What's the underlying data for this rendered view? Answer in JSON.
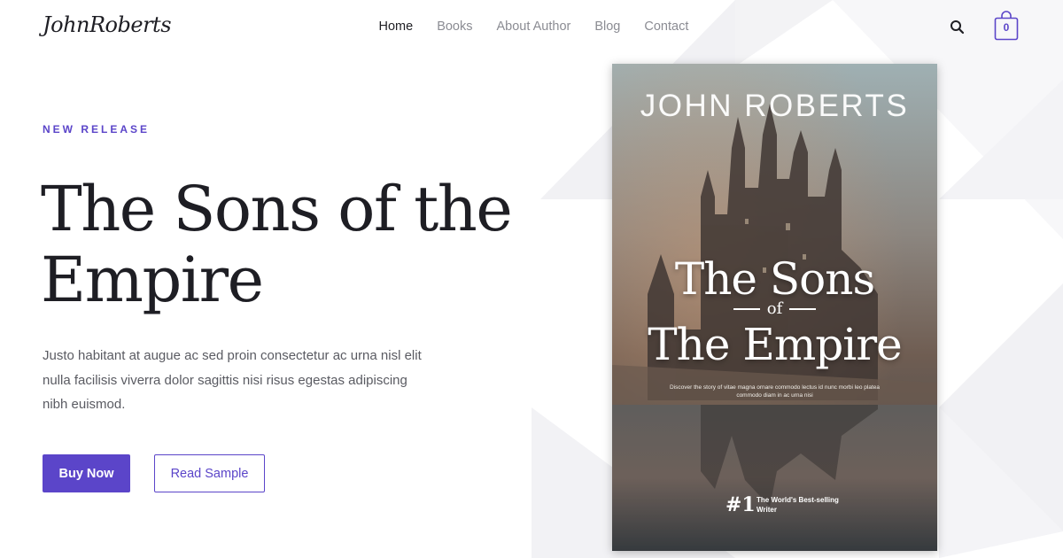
{
  "header": {
    "logo": "JohnRoberts",
    "nav": [
      {
        "label": "Home",
        "active": true
      },
      {
        "label": "Books",
        "active": false
      },
      {
        "label": "About Author",
        "active": false
      },
      {
        "label": "Blog",
        "active": false
      },
      {
        "label": "Contact",
        "active": false
      }
    ],
    "search_icon": "search-icon",
    "cart_icon": "shopping-bag-icon",
    "cart_count": "0"
  },
  "hero": {
    "eyebrow": "NEW RELEASE",
    "title": "The Sons of the Empire",
    "description": "Justo habitant at augue ac sed proin consectetur ac urna nisl elit nulla facilisis viverra dolor sagittis nisi risus egestas adipiscing nibh euismod.",
    "buy_label": "Buy Now",
    "sample_label": "Read Sample"
  },
  "book": {
    "author": "JOHN ROBERTS",
    "title_line1": "The Sons",
    "title_of": "of",
    "title_line2": "The Empire",
    "blurb": "Discover the story of vitae magna ornare commodo lectus id nunc morbi leo platea commodo diam in ac urna nisi",
    "rank": "#1",
    "rank_label": "The World's Best-selling Writer"
  },
  "colors": {
    "accent": "#5b45c9",
    "heading": "#1e1e24",
    "nav_inactive": "#8b8c93",
    "body_text": "#5a5b62"
  }
}
